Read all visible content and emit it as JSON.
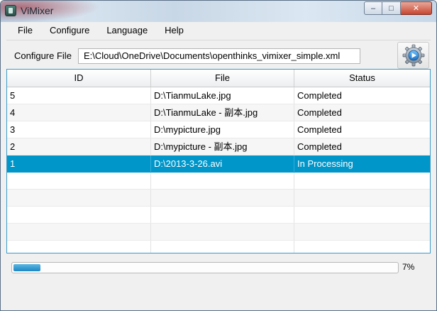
{
  "window": {
    "title": "ViMixer",
    "minimize": "–",
    "maximize": "□",
    "close": "✕"
  },
  "menu": [
    {
      "label": "File"
    },
    {
      "label": "Configure"
    },
    {
      "label": "Language"
    },
    {
      "label": "Help"
    }
  ],
  "config": {
    "label": "Configure File",
    "path": "E:\\Cloud\\OneDrive\\Documents\\openthinks_vimixer_simple.xml",
    "settings_icon": "gear-play-icon"
  },
  "table": {
    "headers": [
      "ID",
      "File",
      "Status"
    ],
    "rows": [
      {
        "id": "5",
        "file": "D:\\TianmuLake.jpg",
        "status": "Completed"
      },
      {
        "id": "4",
        "file": "D:\\TianmuLake - 副本.jpg",
        "status": "Completed"
      },
      {
        "id": "3",
        "file": "D:\\mypicture.jpg",
        "status": "Completed"
      },
      {
        "id": "2",
        "file": "D:\\mypicture - 副本.jpg",
        "status": "Completed"
      },
      {
        "id": "1",
        "file": "D:\\2013-3-26.avi",
        "status": "In Processing"
      }
    ],
    "selected_index": 4
  },
  "progress": {
    "value": 0.07,
    "label": "7%"
  },
  "colors": {
    "selection": "#0096c9",
    "accent_border": "#3c9bc9",
    "progress_fill": "#1d86c2"
  }
}
